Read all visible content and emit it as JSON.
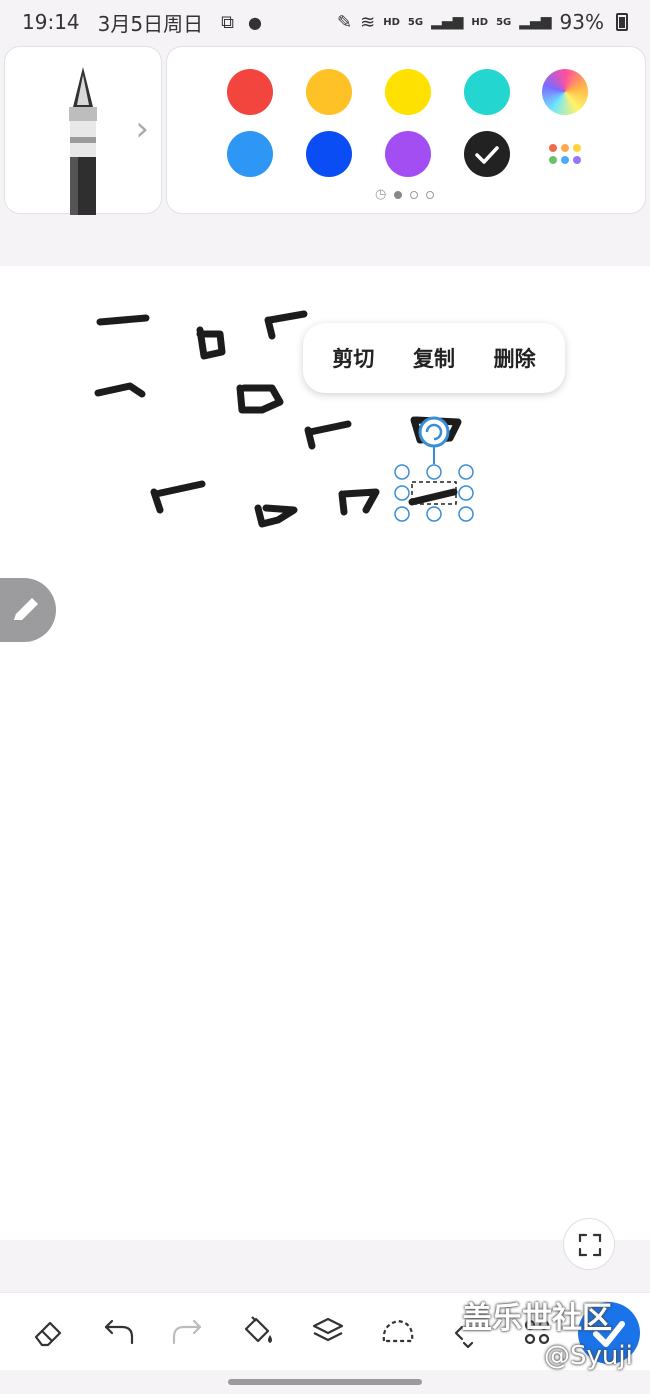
{
  "status_bar": {
    "time": "19:14",
    "date": "3月5日周日",
    "hd1": "HD",
    "net1": "5G",
    "hd2": "HD",
    "net2": "5G",
    "battery": "93%"
  },
  "pen_panel": {
    "pen_icon": "fountain-pen-icon",
    "chevron_icon": "chevron-right-icon"
  },
  "colors": {
    "row1": [
      "#f2453d",
      "#ffc226",
      "#ffe100",
      "#23d6d0",
      "rainbow"
    ],
    "row2": [
      "#2e96f5",
      "#0b4df5",
      "#a34ef2",
      "#222222",
      "palette"
    ],
    "selected": "#222222",
    "page_dots": 3,
    "active_page": 1
  },
  "context_menu": {
    "cut": "剪切",
    "copy": "复制",
    "delete": "删除"
  },
  "toolbar": {
    "tools": [
      "eraser-icon",
      "undo-icon",
      "redo-icon",
      "fill-icon",
      "layers-icon",
      "lasso-icon",
      "select-icon",
      "more-icon"
    ]
  },
  "watermark": {
    "line1": "盖乐世社区",
    "line2": "@Syuji"
  }
}
